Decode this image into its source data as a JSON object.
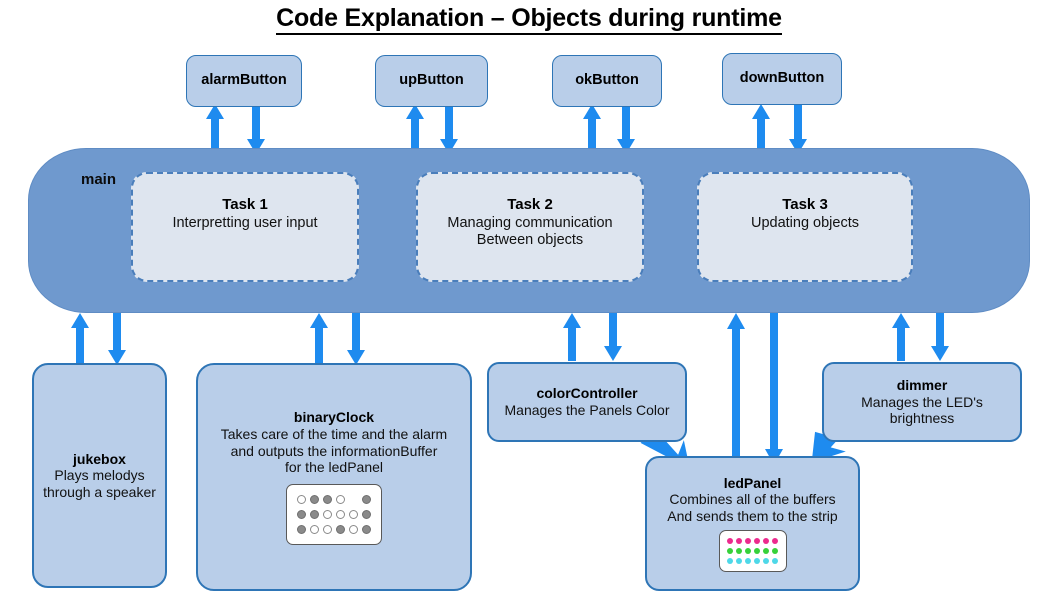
{
  "title": "Code Explanation – Objects during runtime",
  "colors": {
    "main_fill": "#6f99ce",
    "node_fill": "#b9cee9",
    "node_border": "#2e75b6",
    "task_fill": "#dee5ef",
    "task_border": "#4a7ebb",
    "arrow": "#1e8bef",
    "title_text": "#000000"
  },
  "buttons": [
    {
      "name": "alarmButton"
    },
    {
      "name": "upButton"
    },
    {
      "name": "okButton"
    },
    {
      "name": "downButton"
    }
  ],
  "main": {
    "label": "main",
    "tasks": [
      {
        "name": "Task 1",
        "desc": "Interpretting user input"
      },
      {
        "name": "Task 2",
        "desc": "Managing communication\nBetween objects"
      },
      {
        "name": "Task 3",
        "desc": "Updating objects"
      }
    ]
  },
  "objects": [
    {
      "name": "jukebox",
      "desc": "Plays melodys\nthrough a speaker"
    },
    {
      "name": "binaryClock",
      "desc": "Takes care of the time and the alarm\nand outputs the informationBuffer\nfor the ledPanel"
    },
    {
      "name": "colorController",
      "desc": "Manages the Panels Color"
    },
    {
      "name": "dimmer",
      "desc": "Manages the LED's\nbrightness"
    },
    {
      "name": "ledPanel",
      "desc": "Combines all of the buffers\nAnd sends them to the strip"
    }
  ],
  "led_matrices": {
    "binary_clock": {
      "rows": 3,
      "cols": 6,
      "on_color": "#8a8a8a",
      "off_color": "#ffffff",
      "cells": [
        [
          "off",
          "on",
          "on",
          "off",
          "blank",
          "on"
        ],
        [
          "on",
          "on",
          "off",
          "off",
          "off",
          "on"
        ],
        [
          "on",
          "off",
          "off",
          "on",
          "off",
          "on"
        ]
      ]
    },
    "led_panel": {
      "rows": 3,
      "cols": 6,
      "row_colors": [
        "#ec2a8e",
        "#37d13a",
        "#4ed8e8"
      ]
    }
  }
}
